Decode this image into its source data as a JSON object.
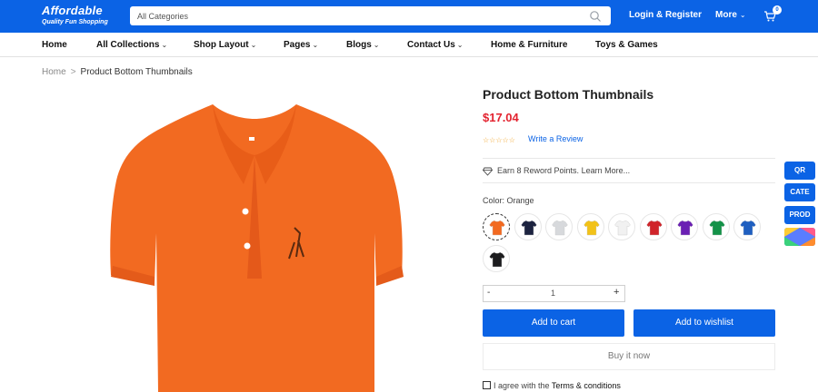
{
  "header": {
    "logo_name": "Affordable",
    "logo_tagline": "Quality Fun Shopping",
    "search_placeholder": "All Categories",
    "login_label": "Login & Register",
    "more_label": "More",
    "cart_count": "0",
    "brand_color": "#0b63e5"
  },
  "nav": {
    "items": [
      {
        "label": "Home",
        "dropdown": false
      },
      {
        "label": "All Collections",
        "dropdown": true
      },
      {
        "label": "Shop Layout",
        "dropdown": true
      },
      {
        "label": "Pages",
        "dropdown": true
      },
      {
        "label": "Blogs",
        "dropdown": true
      },
      {
        "label": "Contact Us",
        "dropdown": true
      },
      {
        "label": "Home & Furniture",
        "dropdown": false
      },
      {
        "label": "Toys & Games",
        "dropdown": false
      }
    ]
  },
  "breadcrumb": {
    "home": "Home",
    "separator": ">",
    "current": "Product Bottom Thumbnails"
  },
  "product": {
    "title": "Product Bottom Thumbnails",
    "price": "$17.04",
    "price_color": "#e3232f",
    "rating_stars": "☆☆☆☆☆",
    "review_link": "Write a Review",
    "points_text": "Earn 8 Reword Points.",
    "points_link": "Learn More...",
    "color_label": "Color: Orange",
    "image_color": "#f26a21",
    "swatches": [
      {
        "name": "Orange",
        "color": "#f26a21",
        "selected": true
      },
      {
        "name": "Navy",
        "color": "#1d2340",
        "selected": false
      },
      {
        "name": "Light Gray",
        "color": "#d7d9dc",
        "selected": false
      },
      {
        "name": "Yellow",
        "color": "#f2c218",
        "selected": false
      },
      {
        "name": "White",
        "color": "#f1f1f1",
        "selected": false
      },
      {
        "name": "Red",
        "color": "#d0242a",
        "selected": false
      },
      {
        "name": "Purple",
        "color": "#6a1fb3",
        "selected": false
      },
      {
        "name": "Green",
        "color": "#139248",
        "selected": false
      },
      {
        "name": "Blue",
        "color": "#1f5fc0",
        "selected": false
      },
      {
        "name": "Black",
        "color": "#1d1d1f",
        "selected": false
      }
    ],
    "quantity": {
      "minus": "-",
      "value": "1",
      "plus": "+"
    },
    "add_to_cart": "Add to cart",
    "add_to_wishlist": "Add to wishlist",
    "buy_now": "Buy it now",
    "agree_prefix": "I agree with the",
    "agree_link": "Terms & conditions"
  },
  "side_tabs": [
    "QR",
    "CATE",
    "PROD"
  ]
}
